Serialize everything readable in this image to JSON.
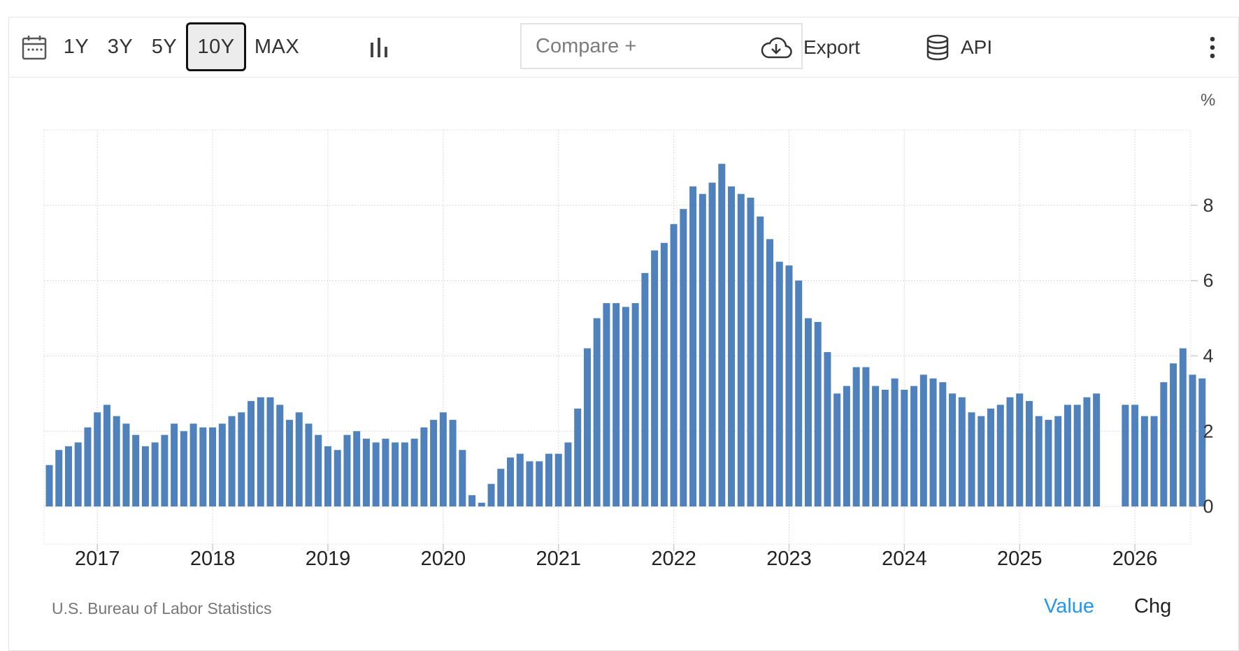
{
  "toolbar": {
    "calendar_icon": "calendar-icon",
    "ranges": [
      "1Y",
      "3Y",
      "5Y",
      "10Y",
      "MAX"
    ],
    "active_range": "10Y",
    "chart_type_icon": "bar-chart-icon",
    "compare_placeholder": "Compare +",
    "export_label": "Export",
    "export_icon": "cloud-download-icon",
    "api_label": "API",
    "api_icon": "database-icon",
    "more_icon": "more-vertical-icon"
  },
  "unit_label": "%",
  "source": "U.S. Bureau of Labor Statistics",
  "value_tab": "Value",
  "chg_tab": "Chg",
  "colors": {
    "bar": "#4f81bd",
    "active_tab": "#2196f3"
  },
  "chart_data": {
    "type": "bar",
    "title": "",
    "xlabel": "",
    "ylabel": "%",
    "ylim": [
      -1,
      10
    ],
    "y_ticks": [
      0,
      2,
      4,
      6,
      8
    ],
    "grid": true,
    "x_tick_labels": [
      "2017",
      "2018",
      "2019",
      "2020",
      "2021",
      "2022",
      "2023",
      "2024",
      "2025",
      "2026"
    ],
    "start": "2016-08",
    "frequency": "monthly",
    "values": [
      1.1,
      1.5,
      1.6,
      1.7,
      2.1,
      2.5,
      2.7,
      2.4,
      2.2,
      1.9,
      1.6,
      1.7,
      1.9,
      2.2,
      2.0,
      2.2,
      2.1,
      2.1,
      2.2,
      2.4,
      2.5,
      2.8,
      2.9,
      2.9,
      2.7,
      2.3,
      2.5,
      2.2,
      1.9,
      1.6,
      1.5,
      1.9,
      2.0,
      1.8,
      1.7,
      1.8,
      1.7,
      1.7,
      1.8,
      2.1,
      2.3,
      2.5,
      2.3,
      1.5,
      0.3,
      0.1,
      0.6,
      1.0,
      1.3,
      1.4,
      1.2,
      1.2,
      1.4,
      1.4,
      1.7,
      2.6,
      4.2,
      5.0,
      5.4,
      5.4,
      5.3,
      5.4,
      6.2,
      6.8,
      7.0,
      7.5,
      7.9,
      8.5,
      8.3,
      8.6,
      9.1,
      8.5,
      8.3,
      8.2,
      7.7,
      7.1,
      6.5,
      6.4,
      6.0,
      5.0,
      4.9,
      4.1,
      3.0,
      3.2,
      3.7,
      3.7,
      3.2,
      3.1,
      3.4,
      3.1,
      3.2,
      3.5,
      3.4,
      3.3,
      3.0,
      2.9,
      2.5,
      2.4,
      2.6,
      2.7,
      2.9,
      3.0,
      2.8,
      2.4,
      2.3,
      2.4,
      2.7,
      2.7,
      2.9,
      3.0,
      null,
      null,
      2.7,
      2.7,
      2.4,
      2.4,
      3.3,
      3.8,
      4.2,
      3.5,
      3.4
    ]
  }
}
